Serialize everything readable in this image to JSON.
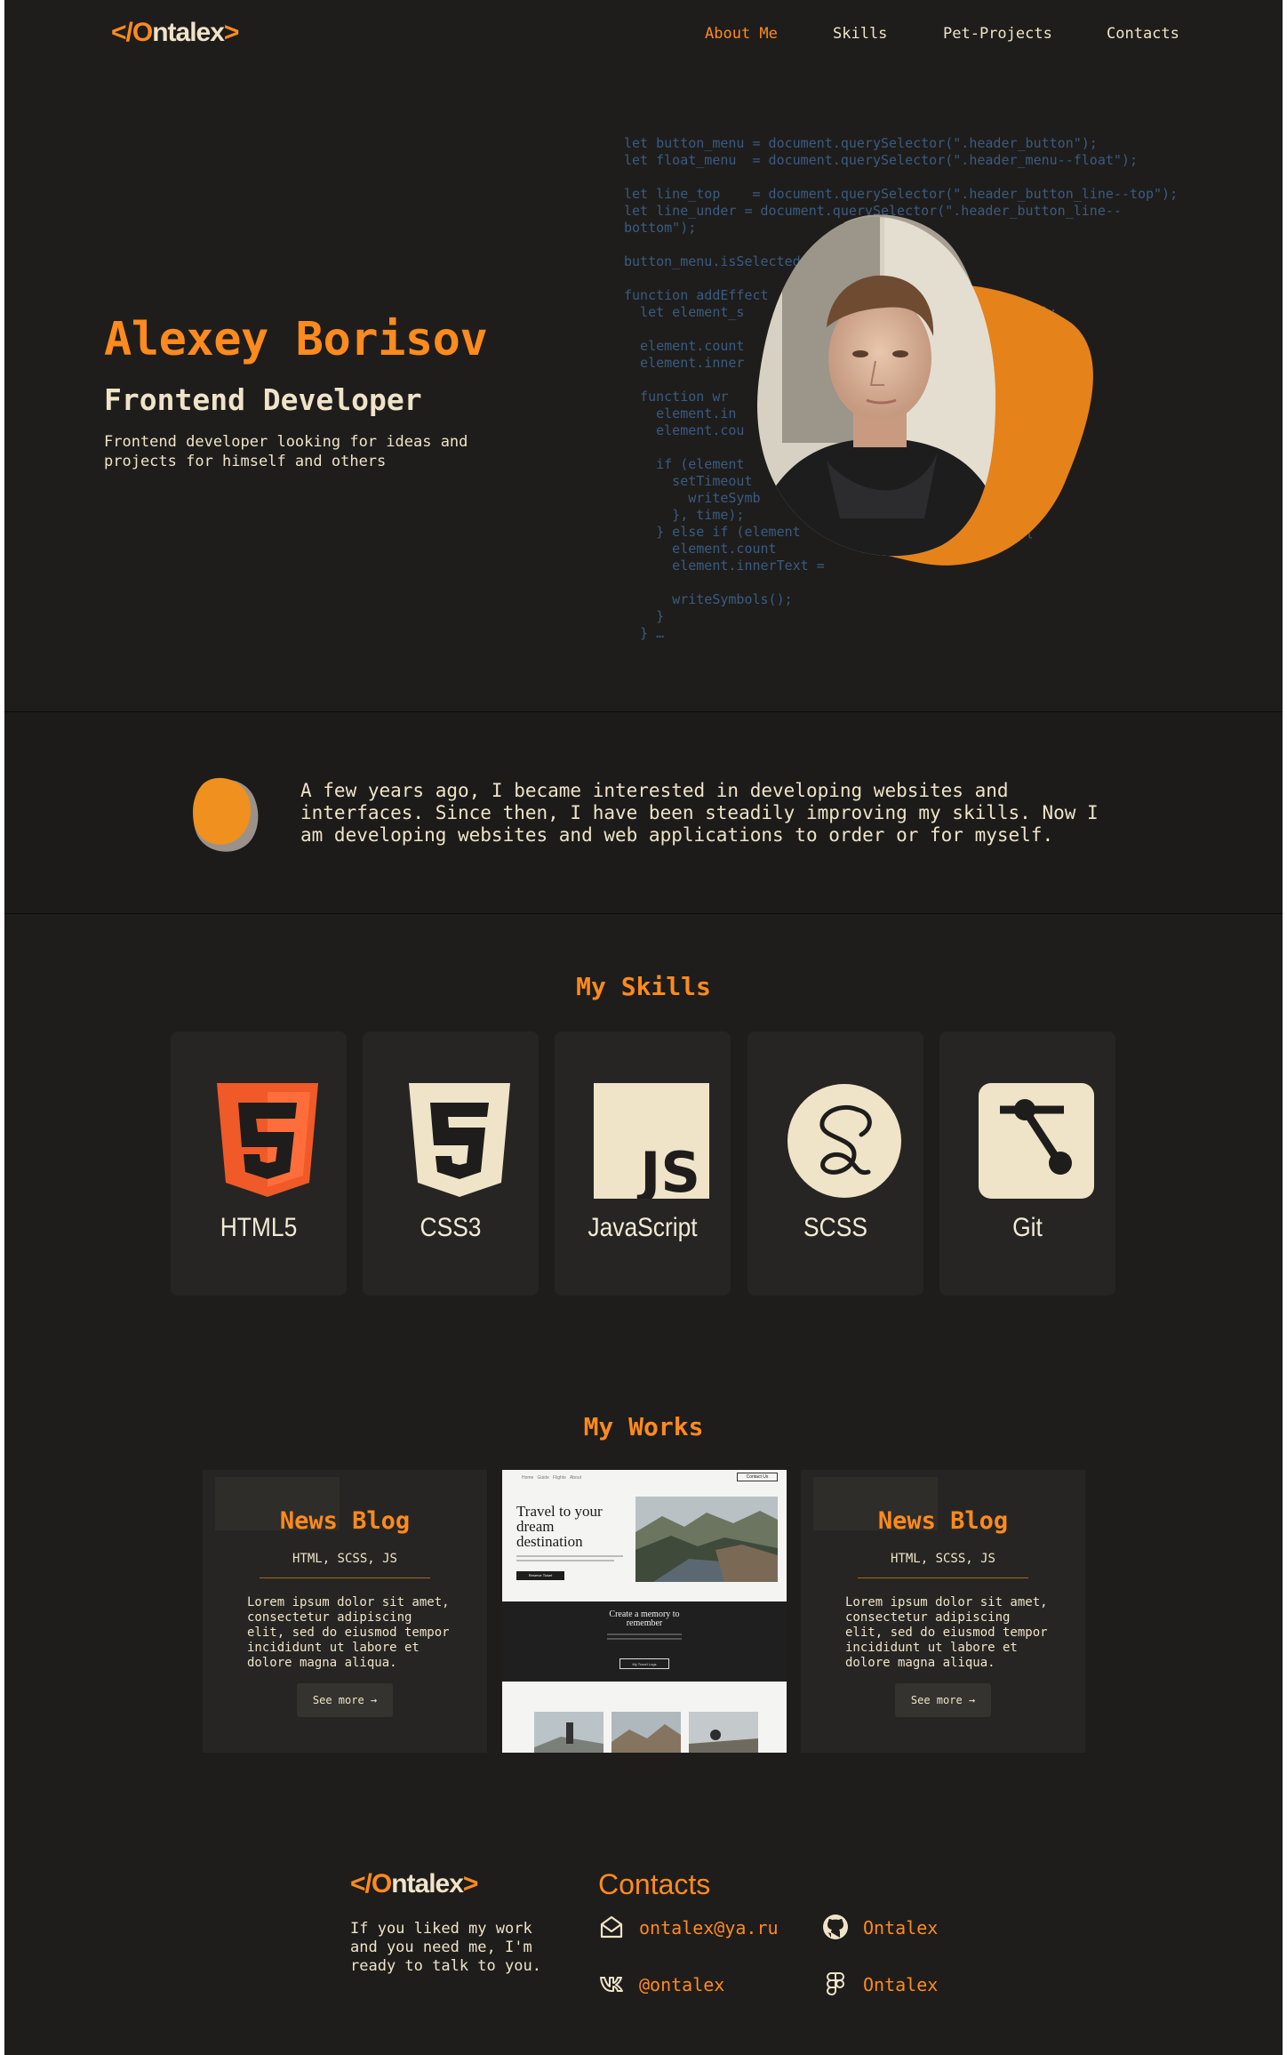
{
  "header": {
    "logo": {
      "bracket_open": "</",
      "o": "O",
      "rest": "ntalex",
      "bracket_close": ">"
    },
    "nav": [
      "About Me",
      "Skills",
      "Pet-Projects",
      "Contacts"
    ],
    "active_nav": "About Me"
  },
  "hero": {
    "name": "Alexey Borisov",
    "role": "Frontend Developer",
    "description": "Frontend developer looking for ideas and projects for himself and others",
    "code": "let button_menu = document.querySelector(\".header_button\");\nlet float_menu  = document.querySelector(\".header_menu--float\");\n\nlet line_top    = document.querySelector(\".header_button_line--top\");\nlet line_under = document.querySelector(\".header_button_line--\nbottom\");\n\nbutton_menu.isSelected\n\nfunction addEffect\n  let element_s                                   s\");\n\n  element.count\n  element.inner\n\n  function wr\n    element.in\n    element.cou\n\n    if (element\n      setTimeout\n        writeSymb\n      }, time);\n    } else if (element                        th) {\n      element.count\n      element.innerText =\n\n      writeSymbols();\n    }\n  } …"
  },
  "about": {
    "text": "A few years ago, I became interested in developing websites and interfaces. Since then, I have been steadily improving my skills. Now I am developing websites and web applications to order or for myself."
  },
  "skills": {
    "title": "My Skills",
    "items": [
      {
        "label": "HTML5",
        "icon": "html5-icon"
      },
      {
        "label": "CSS3",
        "icon": "css3-icon"
      },
      {
        "label": "JavaScript",
        "icon": "javascript-icon"
      },
      {
        "label": "SCSS",
        "icon": "sass-icon"
      },
      {
        "label": "Git",
        "icon": "git-icon"
      }
    ]
  },
  "works": {
    "title": "My Works",
    "cards": [
      {
        "title": "News Blog",
        "tech": "HTML, SCSS, JS",
        "description": "Lorem ipsum dolor sit amet, consectetur adipiscing elit, sed do eiusmod tempor incididunt ut labore et dolore magna aliqua.",
        "button": "See more →"
      },
      {
        "title": "News Blog",
        "tech": "HTML, SCSS, JS",
        "description": "Lorem ipsum dolor sit amet, consectetur adipiscing elit, sed do eiusmod tempor incididunt ut labore et dolore magna aliqua.",
        "button": "See more →"
      }
    ],
    "preview": {
      "nav": [
        "Home",
        "Guide",
        "Flights",
        "About"
      ],
      "contact": "Contact Us",
      "headline": "Travel to your dream destination",
      "button": "Reserve Ticket",
      "section_title": "Create a memory to remember",
      "section_button": "My Travel Logs"
    }
  },
  "footer": {
    "text": "If you liked my work and you need me, I'm ready to talk to you.",
    "contacts_title": "Contacts",
    "contacts": [
      {
        "label": "ontalex@ya.ru",
        "icon": "mail-icon"
      },
      {
        "label": "Ontalex",
        "icon": "github-icon"
      },
      {
        "label": "@ontalex",
        "icon": "vk-icon"
      },
      {
        "label": "Ontalex",
        "icon": "figma-icon"
      }
    ]
  },
  "colors": {
    "background": "#1e1d1b",
    "accent": "#ff8a1e",
    "text": "#efe3c8",
    "card": "#262523",
    "code": "#3a5b82"
  }
}
